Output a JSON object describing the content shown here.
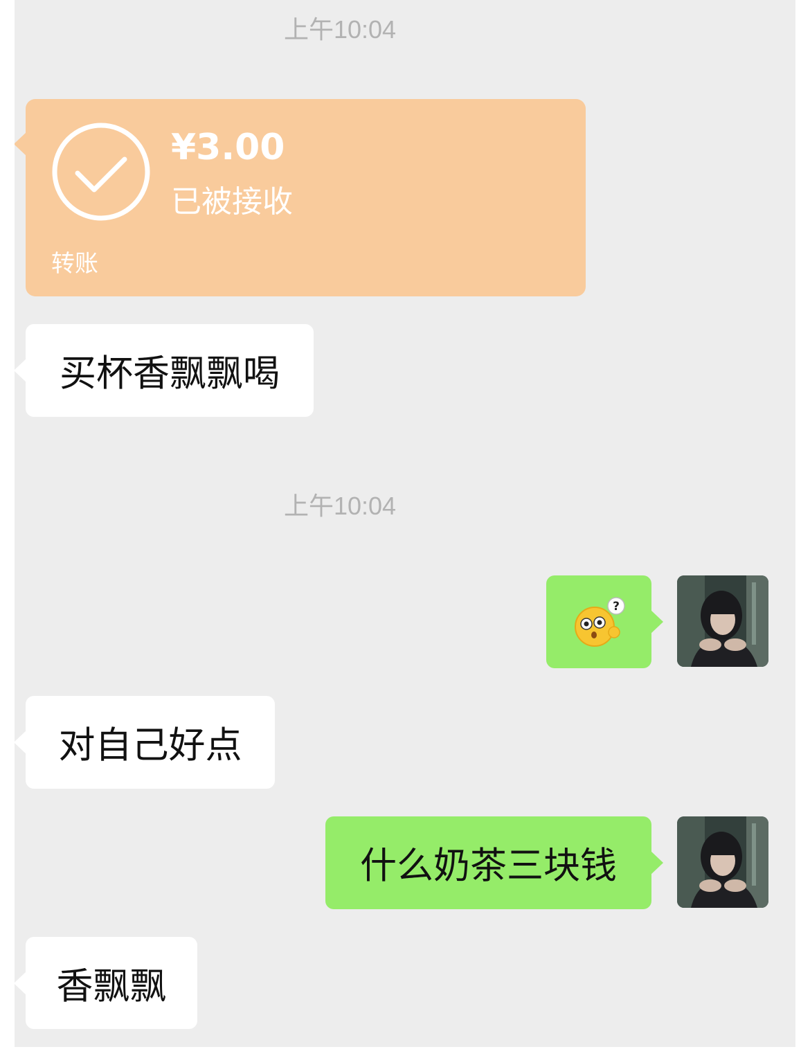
{
  "timestamps": [
    "上午10:04",
    "上午10:04"
  ],
  "transfer": {
    "amount": "¥3.00",
    "status": "已被接收",
    "label": "转账",
    "icon": "check-circle-icon",
    "color": "#f9cb9c"
  },
  "messages": [
    {
      "side": "left",
      "text": "买杯香飘飘喝"
    },
    {
      "side": "right",
      "sticker": "confused-face-emoji"
    },
    {
      "side": "left",
      "text": "对自己好点"
    },
    {
      "side": "right",
      "text": "什么奶茶三块钱"
    },
    {
      "side": "left",
      "text": "香飘飘"
    }
  ],
  "colors": {
    "background": "#ededed",
    "bubble_left": "#ffffff",
    "bubble_right": "#95ec69",
    "timestamp": "#b2b2b2"
  }
}
